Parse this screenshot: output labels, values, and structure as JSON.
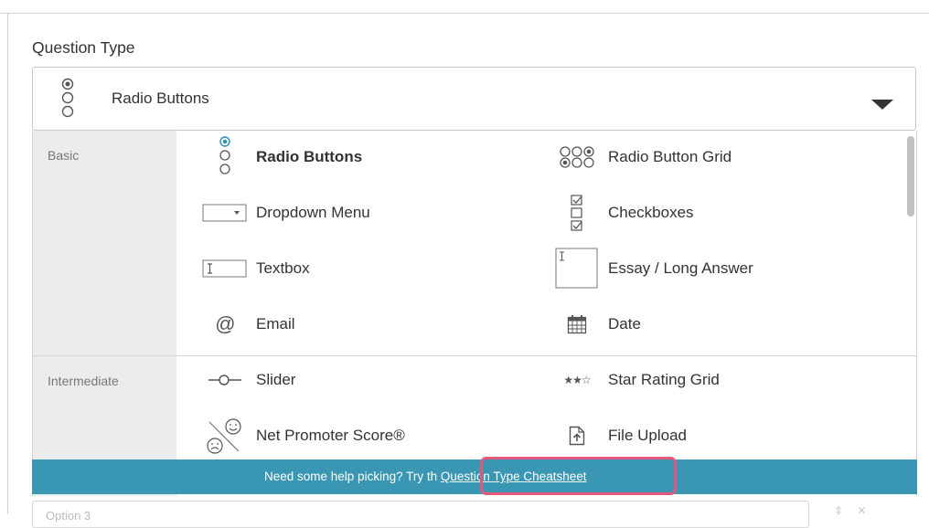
{
  "question_type_label": "Question Type",
  "select": {
    "selected": "Radio Buttons",
    "icon": "radio-buttons-icon"
  },
  "categories": [
    {
      "label": "Basic"
    },
    {
      "label": "Intermediate"
    }
  ],
  "options": {
    "radio_buttons": {
      "label": "Radio Buttons",
      "icon": "radio-buttons-icon",
      "selected": true
    },
    "radio_button_grid": {
      "label": "Radio Button Grid",
      "icon": "radio-grid-icon"
    },
    "dropdown_menu": {
      "label": "Dropdown Menu",
      "icon": "dropdown-icon"
    },
    "checkboxes": {
      "label": "Checkboxes",
      "icon": "checkboxes-icon"
    },
    "textbox": {
      "label": "Textbox",
      "icon": "textbox-icon"
    },
    "essay": {
      "label": "Essay / Long Answer",
      "icon": "essay-icon"
    },
    "email": {
      "label": "Email",
      "icon": "at-icon"
    },
    "date": {
      "label": "Date",
      "icon": "calendar-icon"
    },
    "slider": {
      "label": "Slider",
      "icon": "slider-icon"
    },
    "star_rating_grid": {
      "label": "Star Rating Grid",
      "icon": "stars-icon"
    },
    "nps": {
      "label": "Net Promoter Score®",
      "icon": "smiley-icon"
    },
    "file_upload": {
      "label": "File Upload",
      "icon": "file-upload-icon"
    }
  },
  "help": {
    "prefix": "Need some help picking? Try th",
    "link": "Question Type Cheatsheet"
  },
  "bottom_field": {
    "placeholder": "Option 3"
  },
  "colors": {
    "help_bar": "#3a97b4",
    "highlight": "#e2577a",
    "radio_accent": "#2f8fb5"
  }
}
